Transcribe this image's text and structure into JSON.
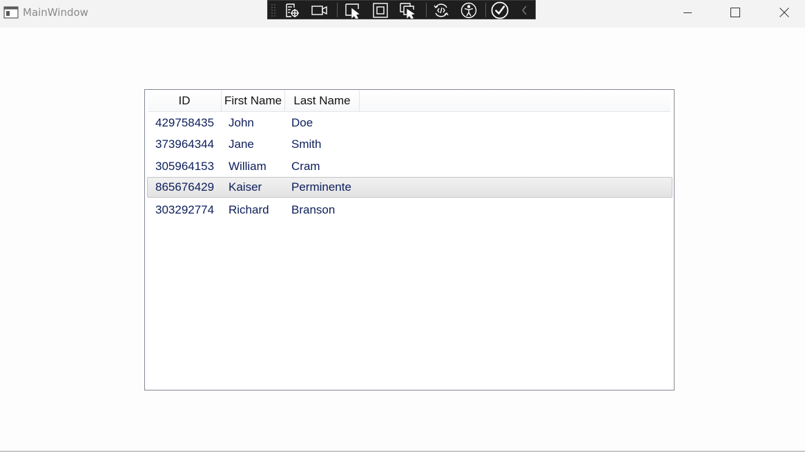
{
  "window": {
    "title": "MainWindow",
    "controls": [
      "minimize-icon",
      "maximize-icon",
      "close-icon"
    ]
  },
  "debug_toolbar": {
    "buttons": [
      "select-element-icon",
      "track-focus-camera-icon",
      "pointer-select-icon",
      "display-layout-adorners-icon",
      "select-in-live-tree-icon",
      "hot-reload-icon",
      "accessibility-icon",
      "checkmark-icon",
      "collapse-chevron-icon"
    ]
  },
  "listview": {
    "columns": [
      {
        "label": "ID"
      },
      {
        "label": "First Name"
      },
      {
        "label": "Last Name"
      }
    ],
    "rows": [
      {
        "id": "429758435",
        "first": "John",
        "last": "Doe"
      },
      {
        "id": "373964344",
        "first": "Jane",
        "last": "Smith"
      },
      {
        "id": "305964153",
        "first": "William",
        "last": "Cram"
      },
      {
        "id": "865676429",
        "first": "Kaiser",
        "last": "Perminente"
      },
      {
        "id": "303292774",
        "first": "Richard",
        "last": "Branson"
      }
    ],
    "selected_row_index": 3
  },
  "colors": {
    "titlebar_bg": "#f3f3f3",
    "toolbar_bg": "#1e1e1e",
    "cell_text": "#0c1e5b",
    "border": "#828790"
  }
}
